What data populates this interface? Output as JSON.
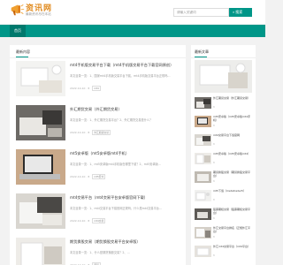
{
  "header": {
    "logo_title": "资讯网",
    "logo_subtitle": "最新资讯尽在本站",
    "search_placeholder": "请输入关键词",
    "search_button": "搜索",
    "search_icon": "search-icon"
  },
  "nav": {
    "home": "首页"
  },
  "main": {
    "section_title": "最新内容",
    "articles": [
      {
        "title": "mt4手机版交易平台下载（mt4手机版交易平台下载官网原创）",
        "excerpt": "本文目录一览：1、国家mt4手机版交易平台下载，mt4手机版交易平台正规吗...",
        "date": "2022-10-10",
        "views": "8",
        "tag": "mt4"
      },
      {
        "title": "外汇期货交易（外汇期货交易）",
        "excerpt": "本文目录一览：1、外汇期货交易平台？2、外汇期货交易是什么？",
        "date": "2022-10-10",
        "views": "8",
        "tag": "外汇期货交易"
      },
      {
        "title": "mt5安卓版（mt5安卓版mt4手机）",
        "excerpt": "本文目录一览：1、mt5安卓版mt4手机版在哪里下载？2、mt5安卓版...",
        "date": "2022-10-10",
        "views": "8",
        "tag": "mt5安卓"
      },
      {
        "title": "mt4交易平台（mt4交易平台安卓版官网下载）",
        "excerpt": "本文目录一览：1、mt4交易平台下载官网正规吗，什么是mt4交易平台...",
        "date": "2022-10-10",
        "views": "8",
        "tag": "mt4交易"
      },
      {
        "title": "期货换股交易（期货换股交易平台安卓版）",
        "excerpt": "本文目录一览：1、什么是期货换股交易？2、...",
        "date": "2022-10-10",
        "views": "8",
        "tag": "期货"
      }
    ]
  },
  "sidebar": {
    "section_title": "最新文章",
    "items": [
      {
        "title": "外汇期货交易（外汇期货交易）",
        "num": "8"
      },
      {
        "title": "mt5安卓版（mt5安卓版mt4手机）",
        "num": "8"
      },
      {
        "title": "mt4交易平台下载官网",
        "num": "8"
      },
      {
        "title": "mt5安卓版（mt5安卓版mt4）",
        "num": "8"
      },
      {
        "title": "期货换股交易（期货换股交易平台）",
        "num": "8"
      },
      {
        "title": "mt5下载（metatrader5）",
        "num": "8"
      },
      {
        "title": "股票期权交易（股票期权交易平台）",
        "num": "8"
      },
      {
        "title": "外汇交易平台排名（正规外汇平台）",
        "num": "8"
      },
      {
        "title": "外汇mt4交易平台（mt4平台）",
        "num": "8"
      }
    ]
  }
}
